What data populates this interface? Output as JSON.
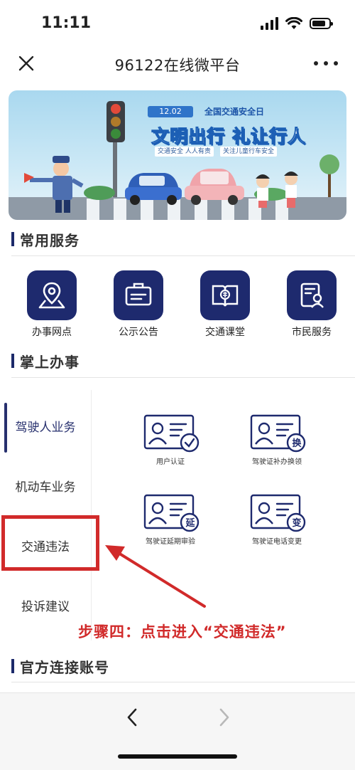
{
  "status_bar": {
    "time": "11:11",
    "battery_level": 0.8
  },
  "nav": {
    "title": "96122在线微平台",
    "close_icon": "close-icon",
    "more_icon": "more-icon"
  },
  "banner": {
    "date": "12.02",
    "day": "全国交通安全日",
    "slogan": "文明出行 礼让行人",
    "tag1": "交通安全 人人有责",
    "tag2": "关注儿童行车安全"
  },
  "sections": {
    "common": "常用服务",
    "handheld": "掌上办事",
    "official": "官方连接账号"
  },
  "services": [
    {
      "label": "办事网点",
      "icon": "map-pin-icon"
    },
    {
      "label": "公示公告",
      "icon": "notice-board-icon"
    },
    {
      "label": "交通课堂",
      "icon": "book-icon"
    },
    {
      "label": "市民服务",
      "icon": "citizen-document-icon"
    }
  ],
  "tabs": [
    {
      "label": "驾驶人业务",
      "active": true
    },
    {
      "label": "机动车业务",
      "active": false
    },
    {
      "label": "交通违法",
      "active": false
    },
    {
      "label": "投诉建议",
      "active": false
    }
  ],
  "business": [
    {
      "label": "用户认证",
      "badge": "✓",
      "icon": "id-card-check-icon"
    },
    {
      "label": "驾驶证补办换领",
      "badge": "换",
      "icon": "id-card-exchange-icon"
    },
    {
      "label": "驾驶证延期审验",
      "badge": "延",
      "icon": "id-card-extend-icon"
    },
    {
      "label": "驾驶证电话变更",
      "badge": "变",
      "icon": "id-card-change-icon"
    }
  ],
  "annotation": {
    "text": "步骤四：点击进入“交通违法”",
    "color": "#d12a2a"
  },
  "toolbar": {
    "back_icon": "chevron-left-icon",
    "forward_icon": "chevron-right-icon"
  },
  "colors": {
    "brand": "#1e2a6e",
    "annotation": "#d12a2a"
  }
}
